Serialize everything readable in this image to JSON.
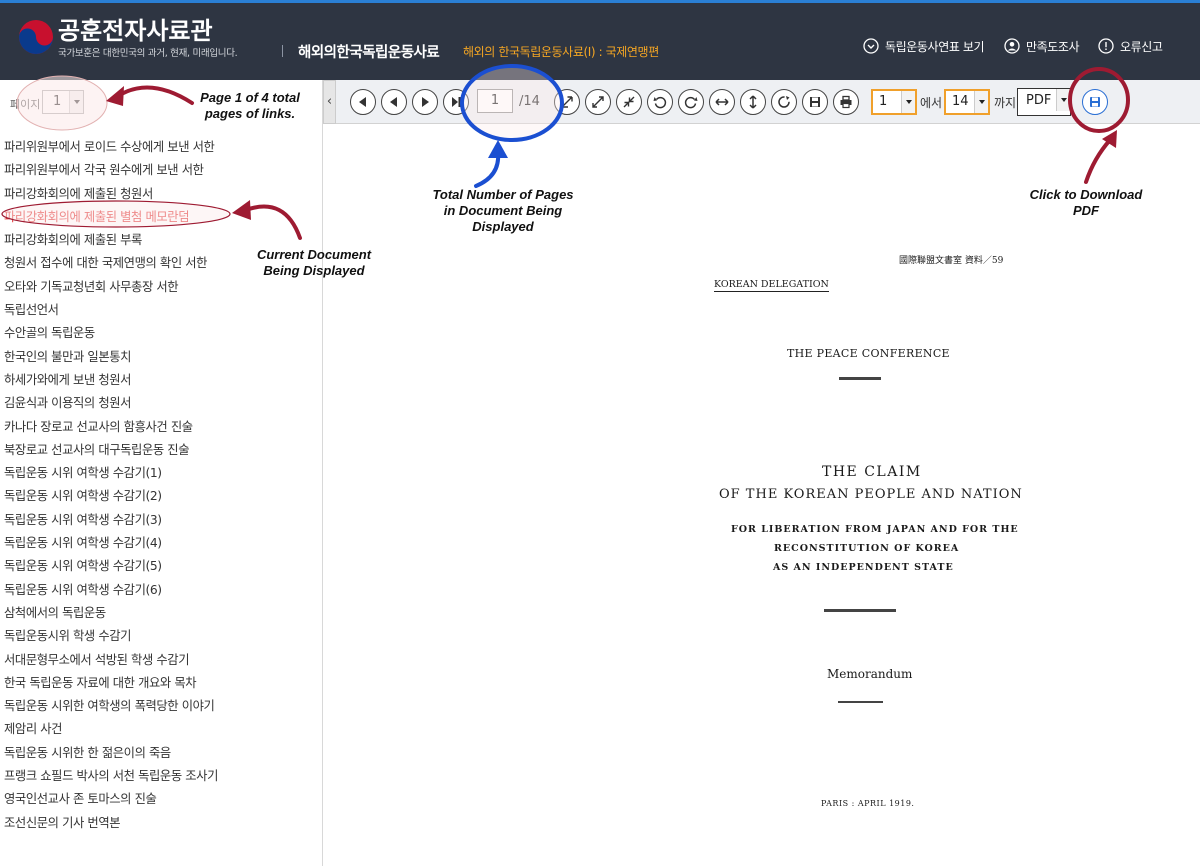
{
  "header": {
    "brand_title": "공훈전자사료관",
    "brand_slogan": "국가보훈은 대한민국의 과거, 현재, 미래입니다.",
    "section_title": "해외의한국독립운동사료",
    "collection_title": "해외의 한국독립운동사료(Ⅰ) : 국제연맹편",
    "links": {
      "chronology": "독립운동사연표 보기",
      "survey": "만족도조사",
      "report": "오류신고"
    }
  },
  "left_panel": {
    "page_label": "페이지",
    "page_value": "1",
    "documents": [
      "파리위원부에서 로이드 수상에게 보낸 서한",
      "파리위원부에서 각국 원수에게 보낸 서한",
      "파리강화회의에 제출된 청원서",
      "파리강화회의에 제출된 별첨 메모란덤",
      "파리강화회의에 제출된 부록",
      "청원서 접수에 대한 국제연맹의 확인 서한",
      "오타와 기독교청년회 사무총장 서한",
      "독립선언서",
      "수안골의 독립운동",
      "한국인의 불만과 일본통치",
      "하세가와에게 보낸 청원서",
      "김윤식과 이용직의 청원서",
      "카나다 장로교 선교사의 함흥사건 진술",
      "북장로교 선교사의 대구독립운동 진술",
      "독립운동 시위 여학생 수감기(1)",
      "독립운동 시위 여학생 수감기(2)",
      "독립운동 시위 여학생 수감기(3)",
      "독립운동 시위 여학생 수감기(4)",
      "독립운동 시위 여학생 수감기(5)",
      "독립운동 시위 여학생 수감기(6)",
      "삼척에서의 독립운동",
      "독립운동시위 학생 수감기",
      "서대문형무소에서 석방된 학생 수감기",
      "한국 독립운동 자료에 대한 개요와 목차",
      "독립운동 시위한 여학생의 폭력당한 이야기",
      "제암리 사건",
      "독립운동 시위한 한 젊은이의 죽음",
      "프랭크 쇼필드 박사의 서천 독립운동 조사기",
      "영국인선교사 존 토마스의 진술",
      "조선신문의 기사 번역본"
    ],
    "current_index": 3
  },
  "toolbar": {
    "current_page": "1",
    "total_pages": "/14",
    "range_from": "1",
    "from_suffix": "에서",
    "range_to": "14",
    "to_suffix": "까지",
    "format": "PDF",
    "buttons": [
      "first-page",
      "prev-page",
      "next-page",
      "last-page",
      "fit-icon",
      "expand-icon",
      "shrink-icon",
      "rotate-left-icon",
      "rotate-right-icon",
      "fit-width-icon",
      "fit-height-icon",
      "reset-icon",
      "save-icon",
      "print-icon",
      "download-icon"
    ]
  },
  "document": {
    "archive_label": "國際聯盟文書室 資料／59",
    "delegation": "KOREAN DELEGATION",
    "conference": "THE PEACE CONFERENCE",
    "claim_line1": "THE CLAIM",
    "claim_line2": "OF THE KOREAN PEOPLE AND NATION",
    "sub_line1": "FOR LIBERATION FROM JAPAN AND FOR THE",
    "sub_line2": "RECONSTITUTION OF KOREA",
    "sub_line3": "AS AN INDEPENDENT STATE",
    "memorandum": "Memorandum",
    "dateline": "PARIS : APRIL 1919."
  },
  "annotations": {
    "page_of_links": "Page 1 of 4 total pages of links.",
    "total_pages": "Total Number of Pages in Document Being Displayed",
    "current_doc": "Current Document Being Displayed",
    "download": "Click to Download PDF",
    "colors": {
      "maroon": "#9e1b32",
      "blue": "#1b4fd1",
      "highlight": "#fbeaea"
    }
  },
  "colors": {
    "header_bg": "#2e3542",
    "accent_orange": "#f5a623",
    "current_doc_red": "#e33b3b"
  }
}
